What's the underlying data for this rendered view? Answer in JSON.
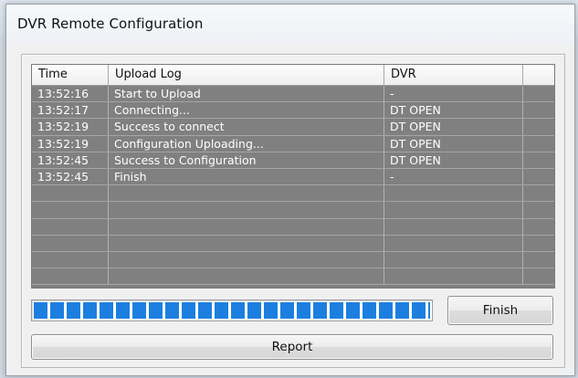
{
  "window": {
    "title": "DVR Remote Configuration"
  },
  "table": {
    "columns": [
      "Time",
      "Upload Log",
      "DVR",
      ""
    ],
    "rows": [
      [
        "13:52:16",
        "Start to Upload",
        "-",
        ""
      ],
      [
        "13:52:17",
        "Connecting...",
        "DT OPEN",
        ""
      ],
      [
        "13:52:19",
        "Success to connect",
        "DT OPEN",
        ""
      ],
      [
        "13:52:19",
        "Configuration Uploading...",
        "DT OPEN",
        ""
      ],
      [
        "13:52:45",
        "Success to Configuration",
        "DT OPEN",
        ""
      ],
      [
        "13:52:45",
        "Finish",
        "-",
        ""
      ],
      [
        "",
        "",
        "",
        ""
      ],
      [
        "",
        "",
        "",
        ""
      ],
      [
        "",
        "",
        "",
        ""
      ],
      [
        "",
        "",
        "",
        ""
      ],
      [
        "",
        "",
        "",
        ""
      ],
      [
        "",
        "",
        "",
        ""
      ]
    ]
  },
  "progress": {
    "percent": 100,
    "fill_color": "#1c7fe0"
  },
  "buttons": {
    "finish": "Finish",
    "report": "Report"
  }
}
